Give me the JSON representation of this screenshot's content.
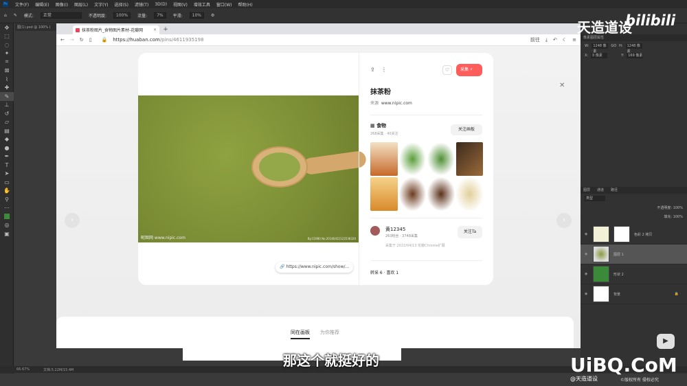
{
  "ps": {
    "menu": [
      "文件(F)",
      "编辑(E)",
      "图像(I)",
      "图层(L)",
      "文字(Y)",
      "选择(S)",
      "滤镜(T)",
      "3D(D)",
      "视图(V)",
      "增效工具",
      "窗口(W)",
      "帮助(H)"
    ],
    "options": {
      "mode_label": "模式:",
      "mode_value": "正常",
      "opacity_label": "不透明度:",
      "opacity_value": "100%",
      "flow_label": "流量:",
      "flow_value": "7%",
      "smooth_label": "平滑:",
      "smooth_value": "10%"
    },
    "doc_tab": "图(1).psd @ 100% (",
    "status_zoom": "66.67%",
    "status_doc": "文档:5.22M/15.4M",
    "props": {
      "title": "像素图层属性",
      "w_label": "W:",
      "w_value": "1248 像素",
      "h_label": "H:",
      "h_value": "1248 像素",
      "x_label": "X:",
      "x_value": "0 像素",
      "y_label": "Y:",
      "y_value": "169 像素",
      "link": "GO"
    },
    "layer_tabs": [
      "图层",
      "通道",
      "路径"
    ],
    "kind_label": "类型",
    "opacity_label": "不透明度: 100%",
    "fill_label": "填充: 100%",
    "layers": [
      {
        "name": "色彩 2 拷贝"
      },
      {
        "name": "图层 1"
      },
      {
        "name": "形状 2"
      },
      {
        "name": "背景"
      }
    ]
  },
  "browser": {
    "tab_title": "抹茶粉图片_食物图片素材-花瓣网",
    "new_tab": "+",
    "url_host": "https://huaban.com",
    "url_path": "/pins/4611935198",
    "right_tools": "前往"
  },
  "pin": {
    "collect_label": "采集",
    "title": "抹茶粉",
    "source_label": "来源",
    "source_value": "www.nipic.com",
    "board_name": "食物",
    "board_stats": "268采集 · 40关注",
    "follow_board": "关注画板",
    "user_name": "黄12345",
    "user_stats": "263粉丝 · 3748采集",
    "follow_user": "关注Ta",
    "collected_at": "采集于 2022/04/13 花瓣Chrome扩展",
    "repost": "转采 6 · 喜欢 1",
    "source_link": "https://www.nipic.com/show/...",
    "img_wm_left": "昵图网 www.nipic.com",
    "img_wm_right": "By:11980 No.20140422123538320"
  },
  "bottom": {
    "tab_same": "同在画板",
    "tab_rec": "为你推荐"
  },
  "video": {
    "subtitle": "那这个就挺好的",
    "wm_top": "天造道设",
    "wm_bilibili": "bilibili",
    "wm_uibq": "UiBQ.CoM",
    "wm_author": "@天造道设",
    "wm_rights": "©版权所有 侵权必究"
  },
  "colors": {
    "accent": "#ff5c5c",
    "matcha": "#86993a",
    "ps_bg": "#3a3a3a"
  },
  "icons": [
    "home-icon",
    "back-icon",
    "forward-icon",
    "reload-icon",
    "heart-icon",
    "share-icon",
    "close-icon",
    "chevron-left-icon",
    "chevron-right-icon",
    "play-icon"
  ]
}
